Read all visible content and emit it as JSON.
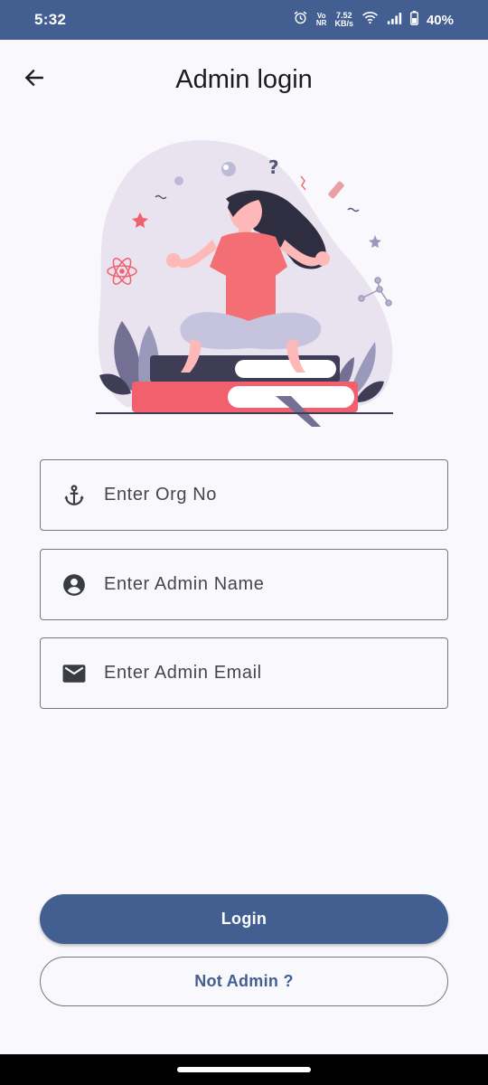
{
  "status_bar": {
    "time": "5:32",
    "network_small_top": "Vo",
    "network_small_bottom": "NR",
    "speed_value": "7.52",
    "speed_unit": "KB/s",
    "battery": "40%",
    "background_color": "#435e91"
  },
  "app_bar": {
    "title": "Admin login",
    "back_icon": "arrow-left-icon"
  },
  "illustration": {
    "description_icon": "meditating-woman-on-books-illustration"
  },
  "form": {
    "org_no": {
      "placeholder": "Enter Org No",
      "value": "",
      "icon": "anchor-icon"
    },
    "admin_name": {
      "placeholder": "Enter Admin Name",
      "value": "",
      "icon": "account-circle-icon"
    },
    "admin_email": {
      "placeholder": "Enter Admin Email",
      "value": "",
      "icon": "mail-icon"
    }
  },
  "actions": {
    "login_label": "Login",
    "not_admin_label": "Not Admin ?"
  },
  "colors": {
    "primary": "#435e91",
    "background": "#f9f9fd",
    "outline": "#75777f",
    "on_surface": "#1b1b21"
  }
}
